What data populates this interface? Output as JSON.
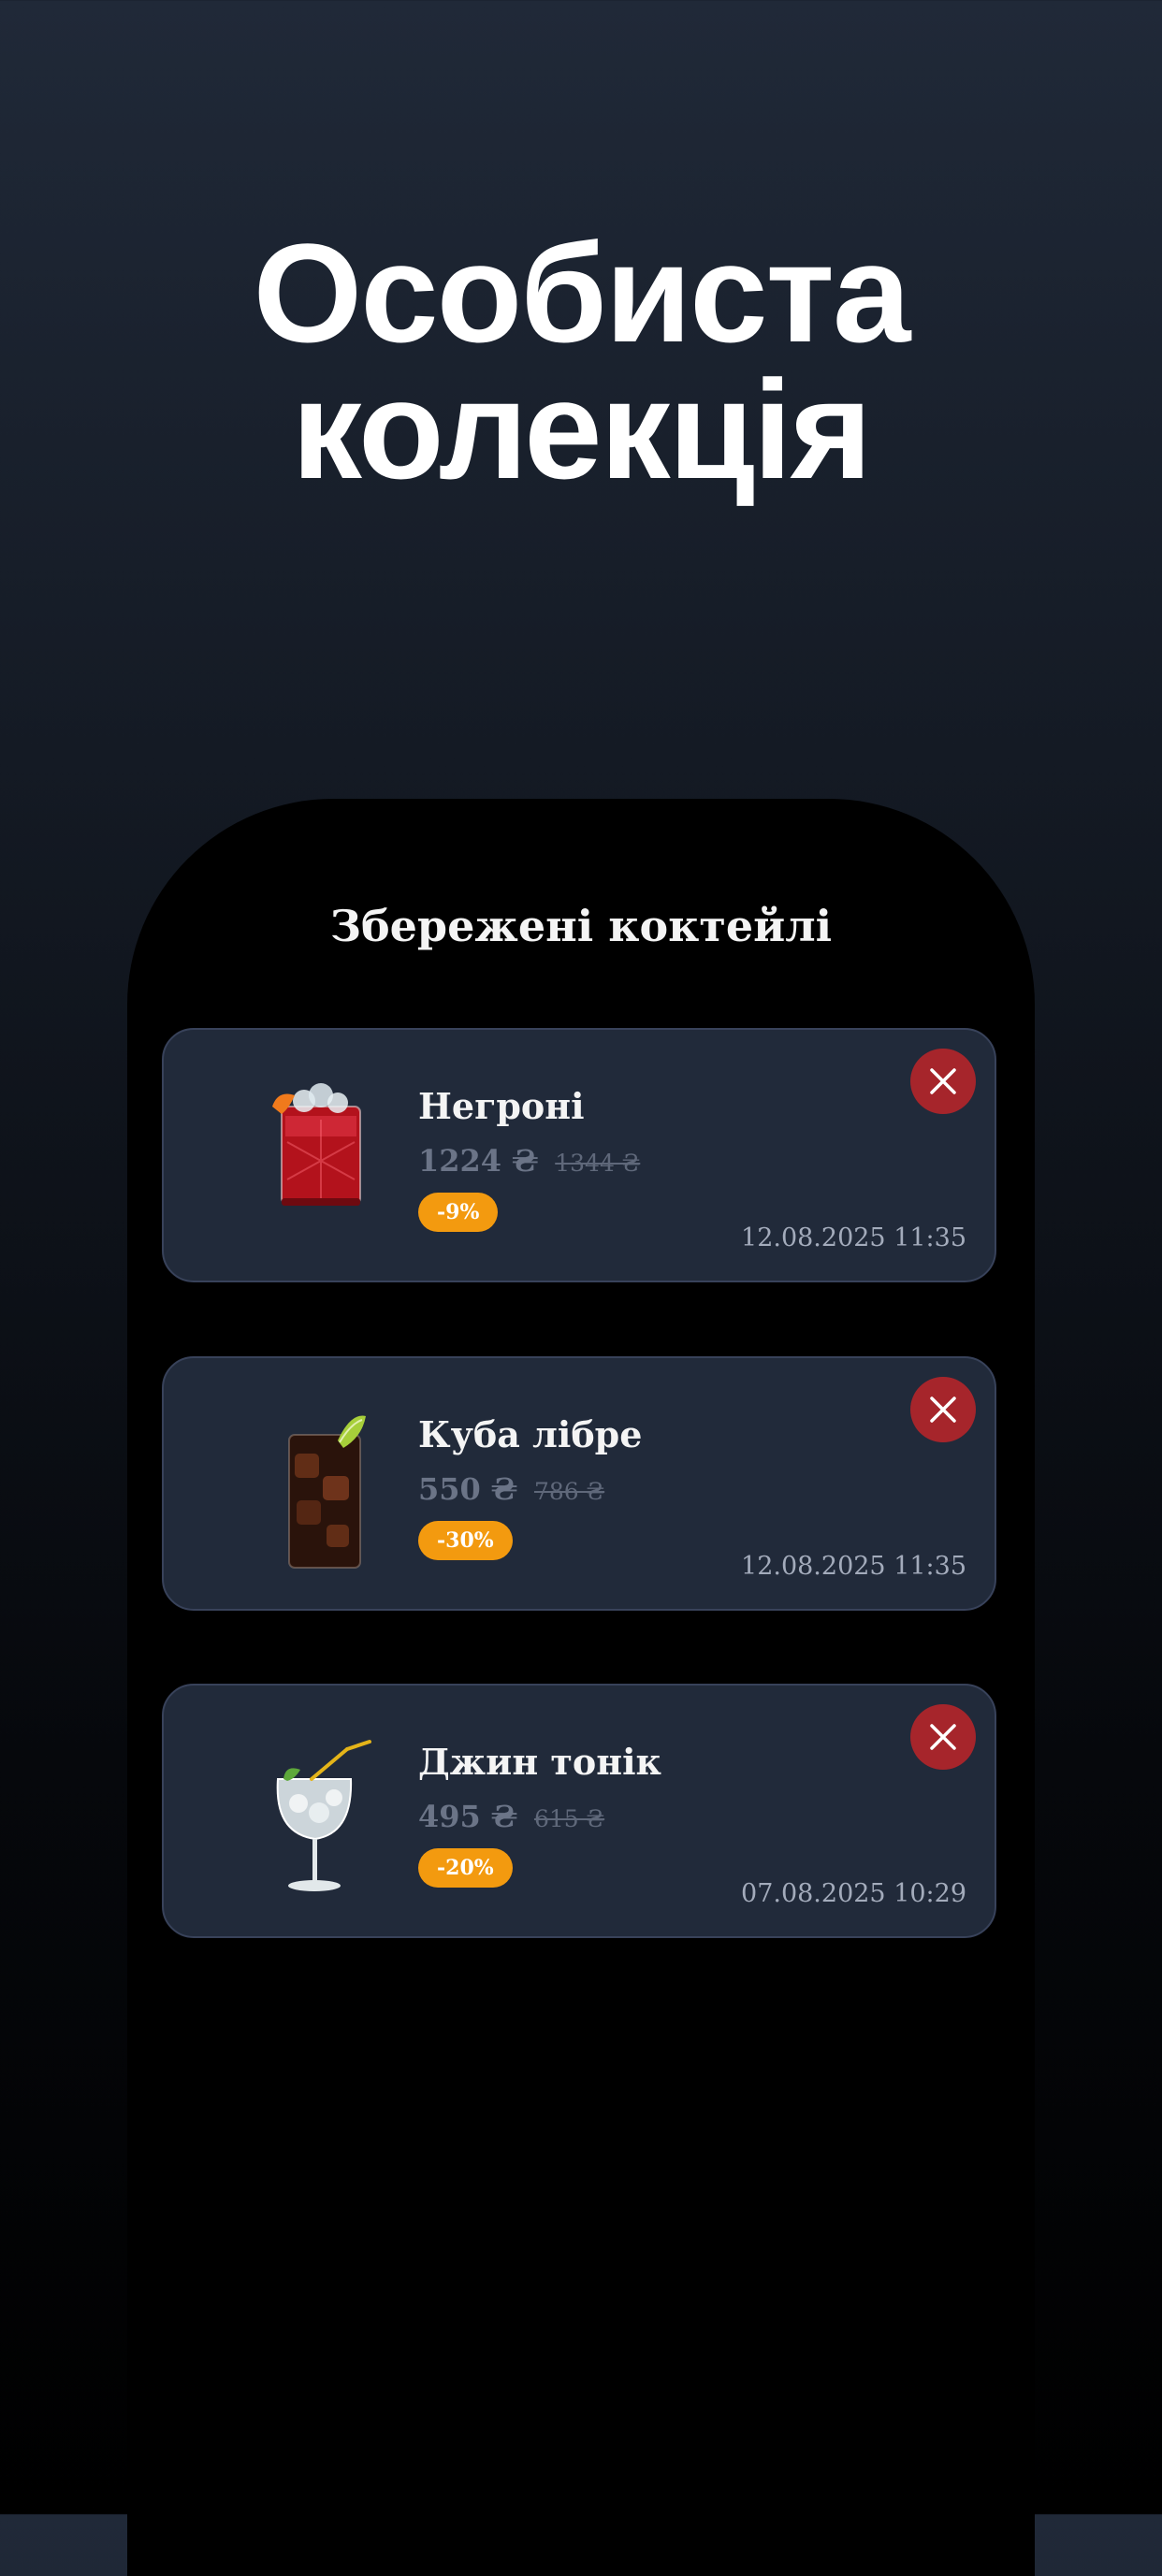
{
  "hero": {
    "title_line1": "Особиста",
    "title_line2": "колекція"
  },
  "screen": {
    "title": "Збережені коктейлі"
  },
  "saved_cocktails": [
    {
      "name": "Негроні",
      "price": "1224 ₴",
      "old_price": "1344 ₴",
      "discount": "-9%",
      "saved_at": "12.08.2025 11:35",
      "image_icon": "negroni-glass-icon",
      "remove_icon": "close-icon"
    },
    {
      "name": "Куба лібре",
      "price": "550 ₴",
      "old_price": "786 ₴",
      "discount": "-30%",
      "saved_at": "12.08.2025 11:35",
      "image_icon": "cuba-libre-glass-icon",
      "remove_icon": "close-icon"
    },
    {
      "name": "Джин тонік",
      "price": "495 ₴",
      "old_price": "615 ₴",
      "discount": "-20%",
      "saved_at": "07.08.2025 10:29",
      "image_icon": "gin-tonic-glass-icon",
      "remove_icon": "close-icon"
    }
  ],
  "colors": {
    "background_top": "#202938",
    "card_background": "#212a3a",
    "card_border": "#38425a",
    "discount_badge": "#f39a0f",
    "remove_button": "#a6252b",
    "price_text": "#6b7487",
    "date_text": "#a3abbb"
  }
}
